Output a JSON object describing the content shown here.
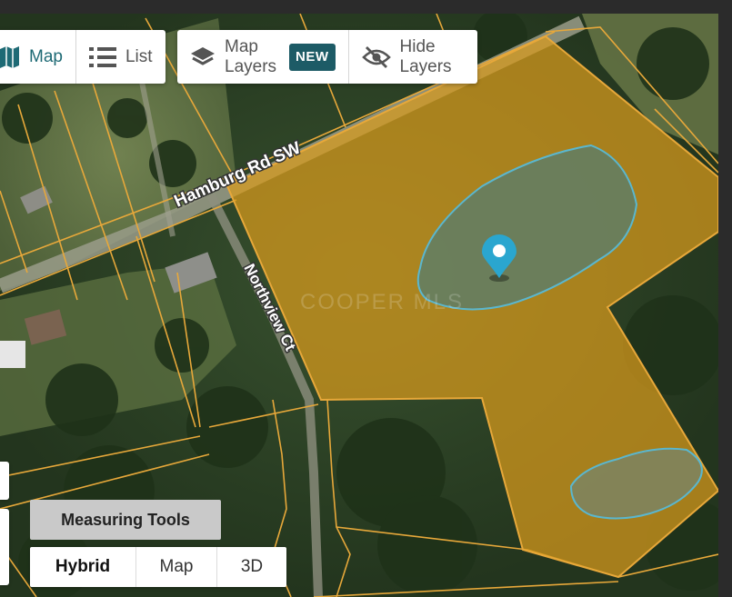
{
  "toolbar": {
    "view_map_label": "Map",
    "view_list_label": "List",
    "map_layers_label_line1": "Map",
    "map_layers_label_line2": "Layers",
    "new_badge": "NEW",
    "hide_layers_label_line1": "Hide",
    "hide_layers_label_line2": "Layers"
  },
  "map": {
    "road_labels": {
      "hamburg": "Hamburg Rd SW",
      "northview": "Northview Ct"
    },
    "watermark": "COOPER MLS",
    "parcel_fill_color": "#d99b1c",
    "parcel_line_color": "#e7a83a",
    "water_color": "#5ab7cf",
    "marker_color": "#2aa6cf",
    "marker_icon": "map-pin-icon"
  },
  "tools": {
    "measuring_label": "Measuring Tools"
  },
  "map_types": {
    "hybrid_label": "Hybrid",
    "map_label": "Map",
    "three_d_label": "3D",
    "selected": "Hybrid"
  }
}
